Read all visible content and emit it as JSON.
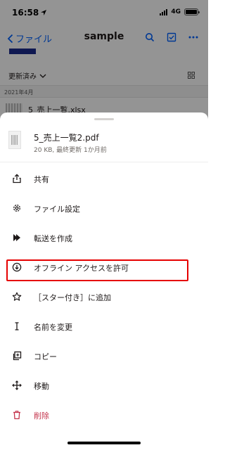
{
  "status_bar": {
    "time": "16:58",
    "network": "4G"
  },
  "nav": {
    "back_label": "ファイル",
    "title": "sample"
  },
  "sort": {
    "label": "更新済み"
  },
  "section": {
    "header": "2021年4月"
  },
  "background_file": {
    "name": "5_売上一覧.xlsx"
  },
  "sheet": {
    "file_name": "5_売上一覧2.pdf",
    "file_meta": "20 KB, 最終更新 1か月前",
    "items": [
      {
        "label": "共有",
        "icon": "share-icon"
      },
      {
        "label": "ファイル設定",
        "icon": "gear-icon"
      },
      {
        "label": "転送を作成",
        "icon": "transfer-icon"
      },
      {
        "label": "オフライン アクセスを許可",
        "icon": "download-circle-icon"
      },
      {
        "label": "［スター付き］に追加",
        "icon": "star-icon"
      },
      {
        "label": "名前を変更",
        "icon": "text-cursor-icon"
      },
      {
        "label": "コピー",
        "icon": "copy-icon"
      },
      {
        "label": "移動",
        "icon": "move-icon"
      },
      {
        "label": "削除",
        "icon": "trash-icon"
      }
    ]
  },
  "colors": {
    "accent": "#0061fe",
    "danger": "#c4334b",
    "highlight": "#e60000"
  }
}
